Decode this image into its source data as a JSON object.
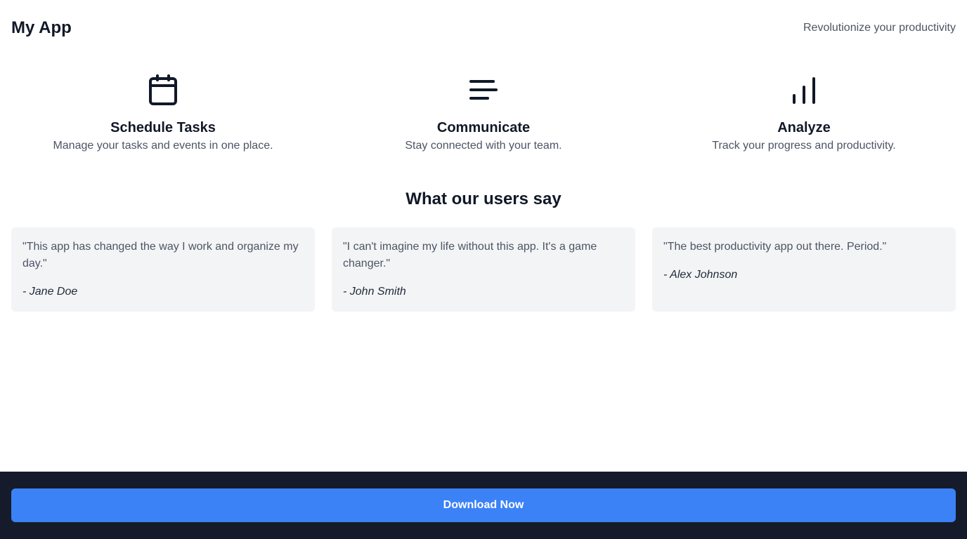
{
  "header": {
    "app_title": "My App",
    "tagline": "Revolutionize your productivity"
  },
  "features": [
    {
      "icon": "calendar-icon",
      "title": "Schedule Tasks",
      "description": "Manage your tasks and events in one place."
    },
    {
      "icon": "message-lines-icon",
      "title": "Communicate",
      "description": "Stay connected with your team."
    },
    {
      "icon": "bar-chart-icon",
      "title": "Analyze",
      "description": "Track your progress and productivity."
    }
  ],
  "testimonials": {
    "title": "What our users say",
    "items": [
      {
        "quote": "\"This app has changed the way I work and organize my day.\"",
        "author": "- Jane Doe"
      },
      {
        "quote": "\"I can't imagine my life without this app. It's a game changer.\"",
        "author": "- John Smith"
      },
      {
        "quote": "\"The best productivity app out there. Period.\"",
        "author": "- Alex Johnson"
      }
    ]
  },
  "footer": {
    "download_label": "Download Now"
  },
  "colors": {
    "primary": "#3b82f6",
    "footer_background": "#151b2a",
    "card_background": "#f3f4f6",
    "text_dark": "#111827",
    "text_muted": "#4b5563"
  }
}
